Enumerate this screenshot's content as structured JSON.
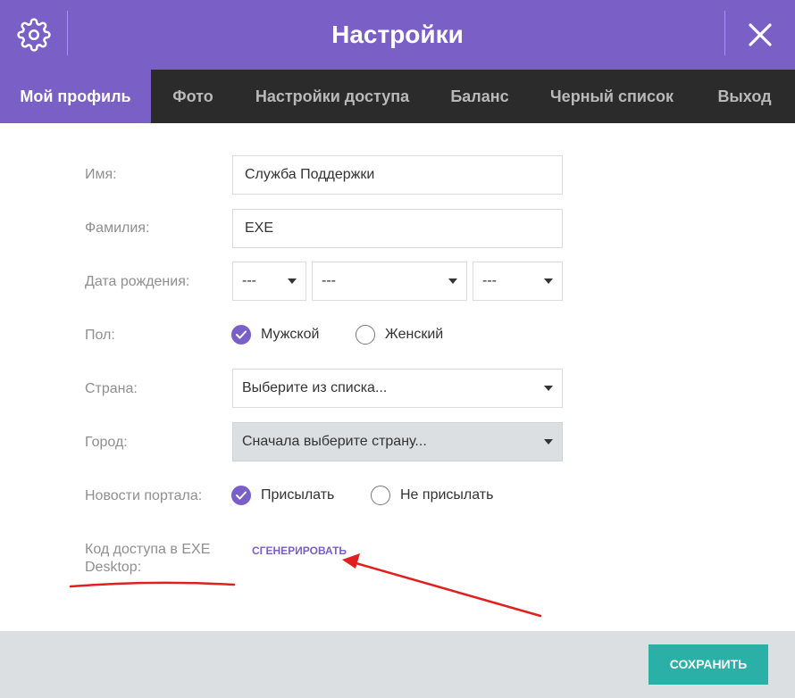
{
  "header": {
    "title": "Настройки",
    "settings_icon": "gear-icon",
    "close_icon": "close-icon",
    "accent_color": "#7a5fc6"
  },
  "tabs": [
    {
      "label": "Мой профиль",
      "active": true
    },
    {
      "label": "Фото",
      "active": false
    },
    {
      "label": "Настройки доступа",
      "active": false
    },
    {
      "label": "Баланс",
      "active": false
    },
    {
      "label": "Черный список",
      "active": false
    },
    {
      "label": "Выход",
      "active": false
    }
  ],
  "form": {
    "first_name": {
      "label": "Имя:",
      "value": "Служба Поддержки"
    },
    "last_name": {
      "label": "Фамилия:",
      "value": "EXE"
    },
    "birth_date": {
      "label": "Дата рождения:",
      "day": "---",
      "month": "---",
      "year": "---"
    },
    "gender": {
      "label": "Пол:",
      "options": [
        "Мужской",
        "Женский"
      ],
      "selected": "Мужской"
    },
    "country": {
      "label": "Страна:",
      "value": "Выберите из списка..."
    },
    "city": {
      "label": "Город:",
      "value": "Сначала выберите страну...",
      "disabled": true
    },
    "news": {
      "label": "Новости портала:",
      "options": [
        "Присылать",
        "Не присылать"
      ],
      "selected": "Присылать"
    },
    "access_code": {
      "label_line1": "Код доступа в EXE",
      "label_line2": "Desktop:",
      "link": "СГЕНЕРИРОВАТЬ"
    }
  },
  "footer": {
    "save_label": "СОХРАНИТЬ",
    "save_color": "#2ab0a6"
  },
  "annotation_color": "#e0201e"
}
